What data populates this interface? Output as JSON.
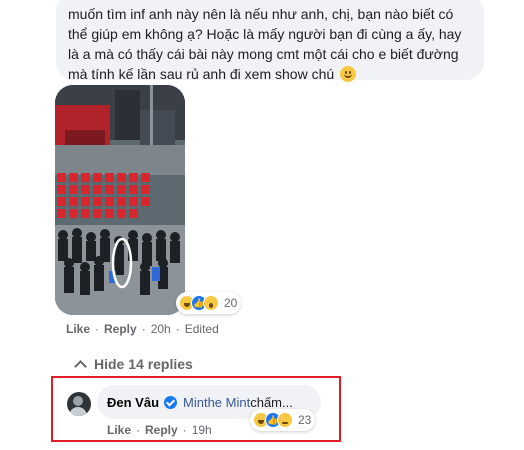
{
  "comment": {
    "lines": [
      "muốn tìm inf anh này nên là nếu như anh, chị, bạn nào biết có",
      "thể giúp em không ạ? Hoặc là mấy người bạn đi cùng a ấy, hay",
      "là a mà có thấy cái bài này mong cmt một cái cho e biết đường",
      "mà tính kế lần sau rủ anh đi xem show chú"
    ],
    "reaction_count": "20",
    "actions": {
      "like": "Like",
      "reply": "Reply",
      "time": "20h",
      "edited": "Edited"
    }
  },
  "hide_replies": "Hide 14 replies",
  "reply": {
    "author": "Đen Vâu",
    "mention": "Minthe Mint",
    "text": " chấm...",
    "reaction_count": "23",
    "actions": {
      "like": "Like",
      "reply": "Reply",
      "time": "19h"
    }
  },
  "colors": {
    "highlight_border": "#e21f26",
    "link_blue": "#385898",
    "bubble_gray": "#f0f2f5",
    "meta_gray": "#65676b"
  },
  "icons": [
    "smile-emoji-icon",
    "haha-reaction-icon",
    "like-reaction-icon",
    "wow-reaction-icon",
    "sad-reaction-icon",
    "verified-badge-icon",
    "chevron-up-icon"
  ]
}
